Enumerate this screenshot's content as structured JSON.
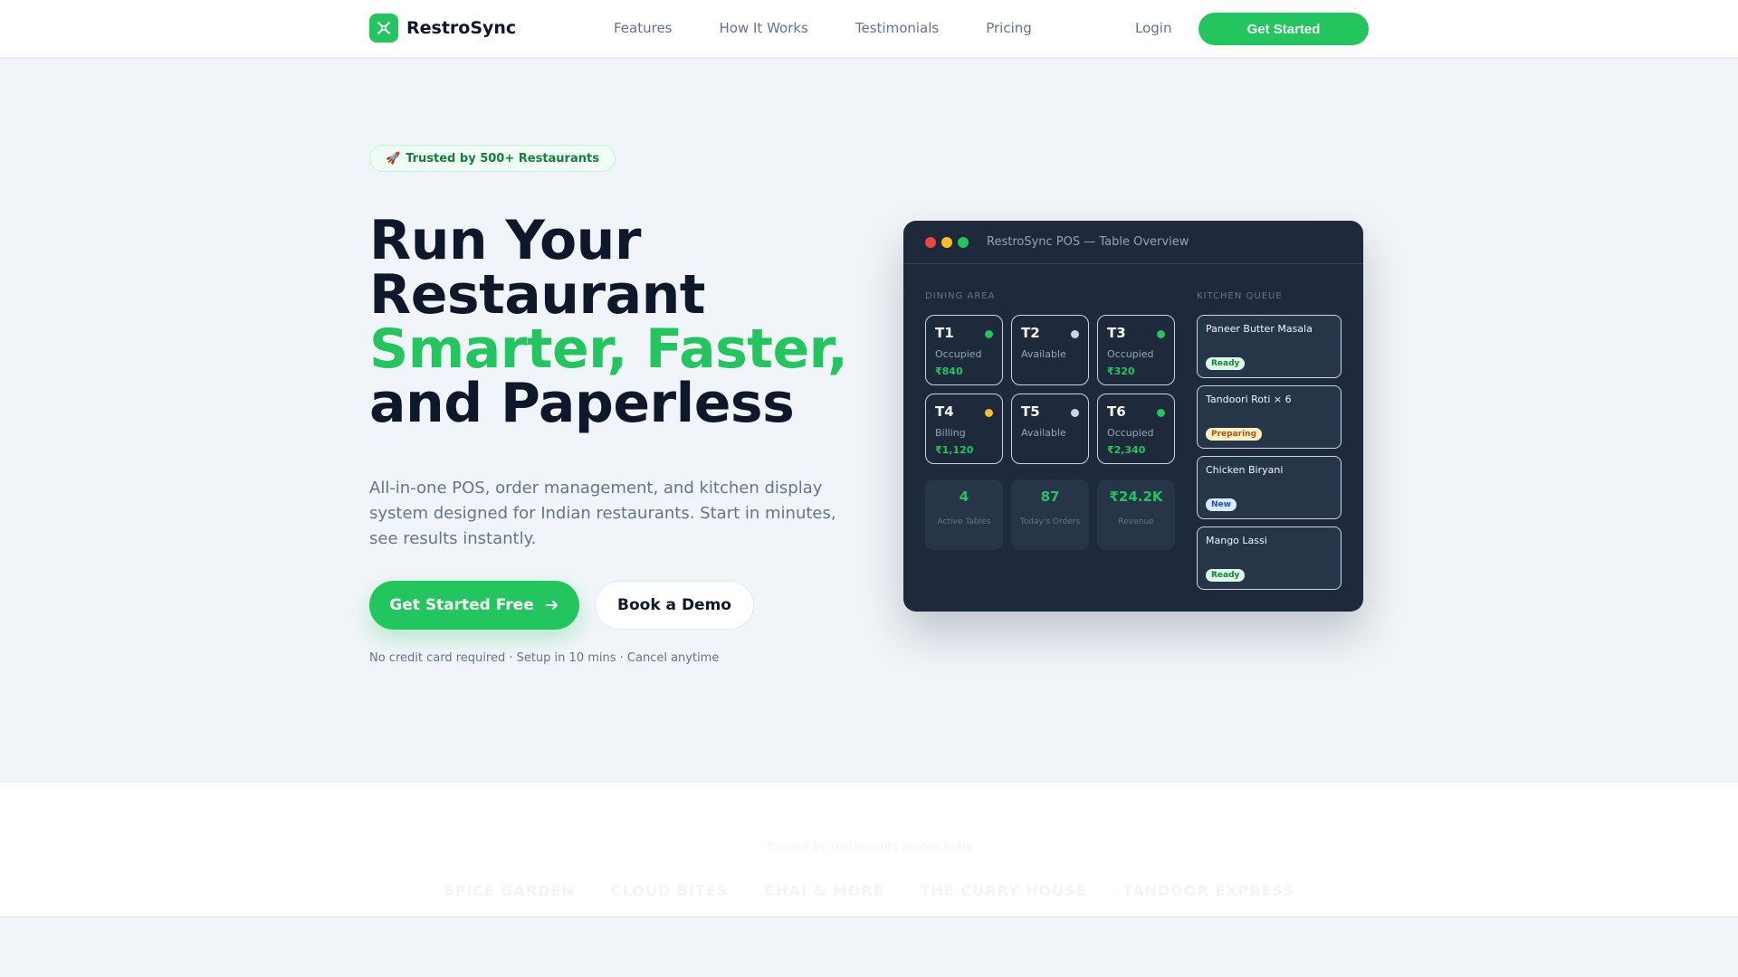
{
  "nav": {
    "brand": "RestroSync",
    "links": [
      "Features",
      "How It Works",
      "Testimonials",
      "Pricing"
    ],
    "login": "Login",
    "cta": "Get Started"
  },
  "hero": {
    "badge_icon": "rocket-icon",
    "badge": "Trusted by 500+ Restaurants",
    "headline_line1": "Run Your",
    "headline_line2": "Restaurant",
    "headline_accent": "Smarter, Faster,",
    "headline_line4": "and Paperless",
    "subtext": "All-in-one POS, order management, and kitchen display system designed for Indian restaurants. Start in minutes, see results instantly.",
    "primary_cta": "Get Started Free",
    "secondary_cta": "Book a Demo",
    "note": "No credit card required · Setup in 10 mins · Cancel anytime"
  },
  "pos": {
    "title": "RestroSync POS — Table Overview",
    "dining_label": "DINING AREA",
    "kitchen_label": "KITCHEN QUEUE",
    "tables": [
      {
        "name": "T1",
        "status": "Occupied",
        "amount": "₹840",
        "dot": "#22c55e"
      },
      {
        "name": "T2",
        "status": "Available",
        "amount": "",
        "dot": "#cbd5e1"
      },
      {
        "name": "T3",
        "status": "Occupied",
        "amount": "₹320",
        "dot": "#22c55e"
      },
      {
        "name": "T4",
        "status": "Billing",
        "amount": "₹1,120",
        "dot": "#fbbf24"
      },
      {
        "name": "T5",
        "status": "Available",
        "amount": "",
        "dot": "#cbd5e1"
      },
      {
        "name": "T6",
        "status": "Occupied",
        "amount": "₹2,340",
        "dot": "#22c55e"
      }
    ],
    "stats": [
      {
        "value": "4",
        "label": "Active Tables"
      },
      {
        "value": "87",
        "label": "Today's Orders"
      },
      {
        "value": "₹24.2K",
        "label": "Revenue"
      }
    ],
    "queue": [
      {
        "item": "Paneer Butter Masala",
        "status": "Ready",
        "kind": "ready"
      },
      {
        "item": "Tandoori Roti × 6",
        "status": "Preparing",
        "kind": "preparing"
      },
      {
        "item": "Chicken Biryani",
        "status": "New",
        "kind": "new"
      },
      {
        "item": "Mango Lassi",
        "status": "Ready",
        "kind": "ready"
      }
    ]
  },
  "trusted": {
    "label": "Trusted by restaurants across India",
    "partners": [
      "SPICE GARDEN",
      "CLOUD BITES",
      "CHAI & MORE",
      "THE CURRY HOUSE",
      "TANDOOR EXPRESS"
    ]
  },
  "colors": {
    "accent": "#22c55e",
    "dark": "#0f172a",
    "panel": "#1e293b"
  }
}
